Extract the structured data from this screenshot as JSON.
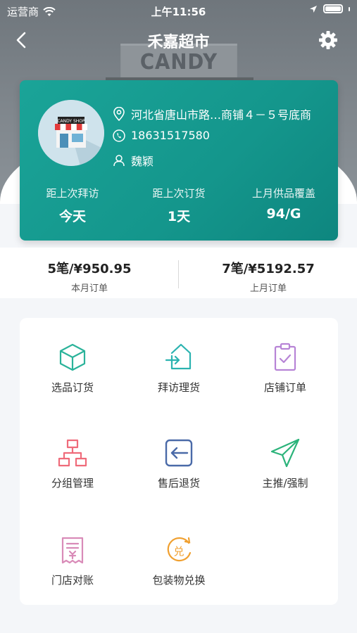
{
  "status_bar": {
    "carrier": "运营商",
    "time": "上午11:56"
  },
  "nav": {
    "title": "禾嘉超市"
  },
  "hero": {
    "sign_text": "CANDY SHOP"
  },
  "store": {
    "avatar_sign": "CANDY SHOP",
    "address": "河北省唐山市路…商铺４－５号底商",
    "phone": "18631517580",
    "contact": "魏颖",
    "stats": [
      {
        "label": "距上次拜访",
        "value": "今天"
      },
      {
        "label": "距上次订货",
        "value": "1天"
      },
      {
        "label": "上月供品覆盖",
        "value": "94/G"
      }
    ]
  },
  "orders": {
    "this_month": {
      "value": "5笔/¥950.95",
      "label": "本月订单"
    },
    "last_month": {
      "value": "7笔/¥5192.57",
      "label": "上月订单"
    }
  },
  "functions": [
    {
      "label": "选品订货",
      "icon": "cube-icon",
      "color": "#2bb39a"
    },
    {
      "label": "拜访理货",
      "icon": "house-arrow-icon",
      "color": "#2bb3b0"
    },
    {
      "label": "店铺订单",
      "icon": "clipboard-check-icon",
      "color": "#b784d6"
    },
    {
      "label": "分组管理",
      "icon": "org-chart-icon",
      "color": "#ef6b7a"
    },
    {
      "label": "售后退货",
      "icon": "return-arrow-icon",
      "color": "#4a6aa8"
    },
    {
      "label": "主推/强制",
      "icon": "paper-plane-icon",
      "color": "#2bb37a"
    },
    {
      "label": "门店对账",
      "icon": "receipt-icon",
      "color": "#d98bb8"
    },
    {
      "label": "包装物兑换",
      "icon": "exchange-coin-icon",
      "color": "#f0a030"
    }
  ]
}
